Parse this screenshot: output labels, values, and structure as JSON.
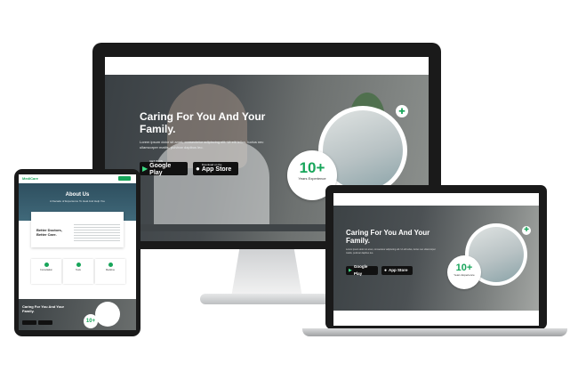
{
  "monitor": {
    "hero_title": "Caring For You And Your Family.",
    "hero_text": "Lorem ipsum dolor sit amet, consectetur adipiscing elit. Ut elit tellus, luctus nec ullamcorper mattis, pulvinar dapibus leo.",
    "google_small": "GET IT ON",
    "google_big": "Google Play",
    "apple_small": "Download on the",
    "apple_big": "App Store",
    "exp_number": "10+",
    "exp_label": "Years Experience"
  },
  "laptop": {
    "hero_title": "Caring For You And Your Family.",
    "hero_text": "Lorem ipsum dolor sit amet, consectetur adipiscing elit. Ut elit tellus, luctus nec ullamcorper mattis, pulvinar dapibus leo.",
    "google_big": "Google Play",
    "apple_big": "App Store",
    "exp_number": "10+",
    "exp_label": "Years Experience"
  },
  "tablet": {
    "logo": "MediCare",
    "about_title": "About Us",
    "about_subtitle": "A Decade of Experience To Heal And Help You",
    "card_title": "Better Doctors, Better Care.",
    "features": [
      "Consultation",
      "Tests",
      "Medicine"
    ],
    "hero_title": "Caring For You And Your Family.",
    "exp_number": "10+"
  },
  "colors": {
    "accent": "#17a55a",
    "bezel": "#1a1a1a"
  },
  "icons": [
    "google-play-icon",
    "apple-icon",
    "stethoscope-icon"
  ]
}
